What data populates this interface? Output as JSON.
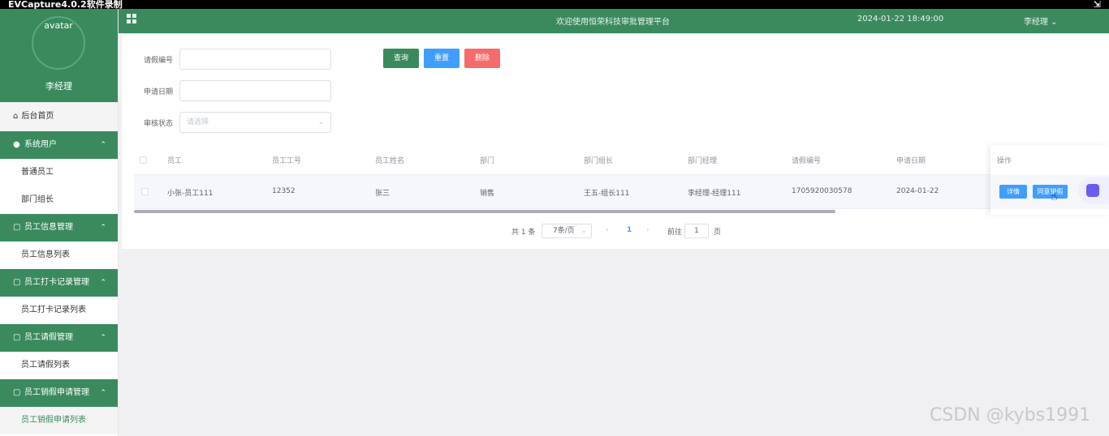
{
  "recorder": {
    "title": "EVCapture4.0.2软件录制"
  },
  "sidebar": {
    "avatar_text": "avatar",
    "user_name": "李经理",
    "home": "后台首页",
    "groups": [
      {
        "label": "系统用户",
        "items": [
          "普通员工",
          "部门组长"
        ]
      },
      {
        "label": "员工信息管理",
        "items": [
          "员工信息列表"
        ]
      },
      {
        "label": "员工打卡记录管理",
        "items": [
          "员工打卡记录列表"
        ]
      },
      {
        "label": "员工请假管理",
        "items": [
          "员工请假列表"
        ]
      },
      {
        "label": "员工销假申请管理",
        "items": [
          "员工销假申请列表"
        ]
      }
    ]
  },
  "header": {
    "welcome": "欢迎使用恒荣科技审批管理平台",
    "datetime": "2024-01-22 18:49:00",
    "user": "李经理"
  },
  "search": {
    "leave_no_label": "请假编号",
    "apply_date_label": "申请日期",
    "status_label": "审核状态",
    "status_placeholder": "请选择",
    "query_btn": "查询",
    "reset_btn": "重置",
    "delete_btn": "删除"
  },
  "table": {
    "columns": [
      "员工",
      "员工工号",
      "员工姓名",
      "部门",
      "部门组长",
      "部门经理",
      "请假编号",
      "申请日期",
      "操作"
    ],
    "rows": [
      [
        "小张-员工111",
        "12352",
        "张三",
        "销售",
        "王五-组长111",
        "李经理-经理111",
        "1705920030578",
        "2024-01-22"
      ]
    ],
    "row_actions": [
      "详情",
      "同意销假"
    ]
  },
  "pagination": {
    "total": "共 1 条",
    "page_size": "7条/页",
    "prev": "‹",
    "current": "1",
    "next": "›",
    "goto_label": "前往",
    "goto_value": "1",
    "page_unit": "页"
  },
  "watermark": "CSDN @kybs1991",
  "colors": {
    "primary_green": "#3a8a5e",
    "blue": "#409eff",
    "red": "#f56c6c"
  }
}
